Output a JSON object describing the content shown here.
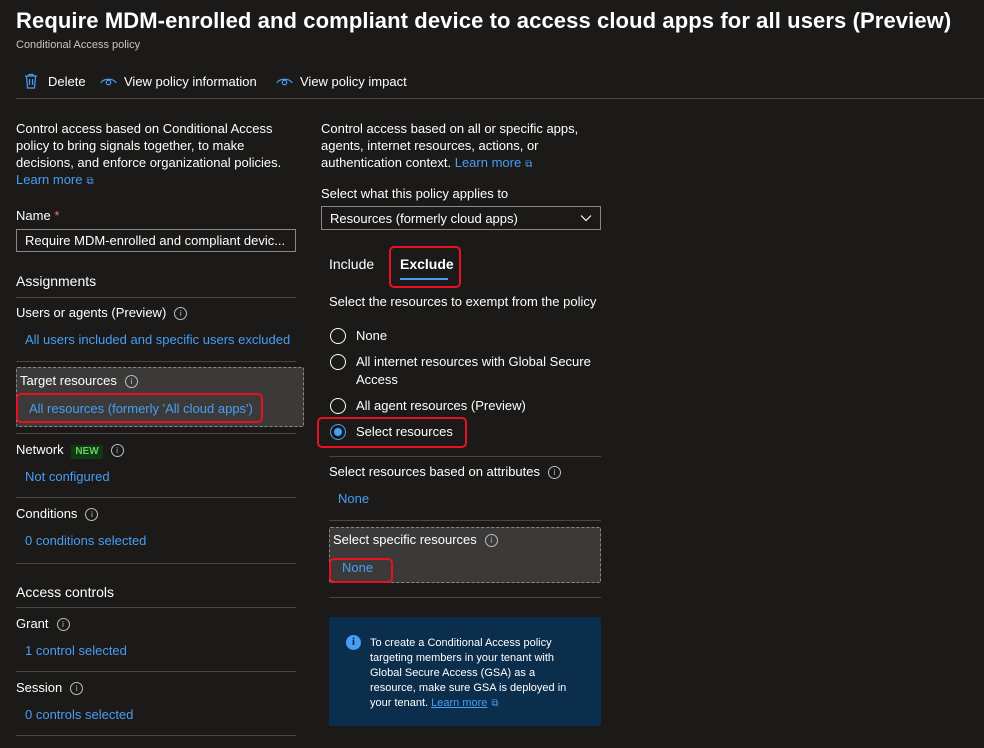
{
  "header": {
    "title": "Require MDM-enrolled and compliant device to access cloud apps for all users (Preview)",
    "subtitle": "Conditional Access policy"
  },
  "toolbar": {
    "delete_label": "Delete",
    "view_info_label": "View policy information",
    "view_impact_label": "View policy impact"
  },
  "left": {
    "description": "Control access based on Conditional Access policy to bring signals together, to make decisions, and enforce organizational policies.",
    "learn_more": "Learn more",
    "name_label": "Name",
    "required_mark": "*",
    "name_value": "Require MDM-enrolled and compliant devic...",
    "assignments_heading": "Assignments",
    "users_label": "Users or agents (Preview)",
    "users_value": "All users included and specific users excluded",
    "target_label": "Target resources",
    "target_value": "All resources (formerly 'All cloud apps')",
    "network_label": "Network",
    "network_badge": "NEW",
    "network_value": "Not configured",
    "conditions_label": "Conditions",
    "conditions_value": "0 conditions selected",
    "access_heading": "Access controls",
    "grant_label": "Grant",
    "grant_value": "1 control selected",
    "session_label": "Session",
    "session_value": "0 controls selected"
  },
  "right": {
    "description": "Control access based on all or specific apps, agents, internet resources, actions, or authentication context.",
    "learn_more": "Learn more",
    "applies_label": "Select what this policy applies to",
    "applies_value": "Resources (formerly cloud apps)",
    "tabs": {
      "include": "Include",
      "exclude": "Exclude"
    },
    "exempt_label": "Select the resources to exempt from the policy",
    "radios": {
      "none": "None",
      "internet_line1": "All internet resources with Global Secure",
      "internet_line2": "Access",
      "agent": "All agent resources (Preview)",
      "select": "Select resources"
    },
    "attributes_label": "Select resources based on attributes",
    "attributes_value": "None",
    "specific_label": "Select specific resources",
    "specific_value": "None",
    "info_box": {
      "line1": "To create a Conditional Access policy",
      "line2": "targeting members in your tenant with",
      "line3": "Global Secure Access (GSA) as a",
      "line4": "resource, make sure GSA is deployed in",
      "line5": "your tenant.",
      "learn_more": "Learn more"
    }
  },
  "colors": {
    "accent": "#479ef5",
    "highlight_box": "#e81123",
    "badge_green": "#6ccb5f",
    "info_bg": "#0c2e4d"
  },
  "icons": [
    "trash-icon",
    "eye-icon",
    "info-icon",
    "external-link-icon",
    "chevron-down-icon"
  ]
}
